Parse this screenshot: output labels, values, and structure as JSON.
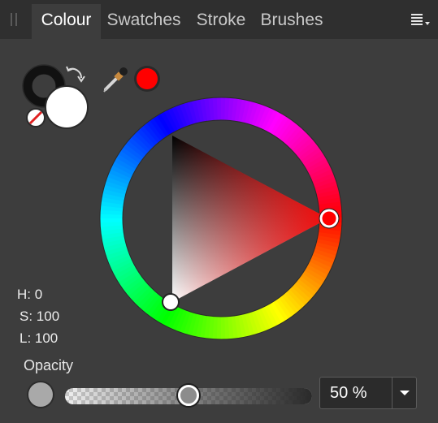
{
  "tabs": [
    {
      "label": "Colour",
      "active": true
    },
    {
      "label": "Swatches",
      "active": false
    },
    {
      "label": "Stroke",
      "active": false
    },
    {
      "label": "Brushes",
      "active": false
    }
  ],
  "panel_menu_icon": "hamburger-menu-icon",
  "colour": {
    "fill_color": "#ffffff",
    "stroke_color": "#111111",
    "picked_color": "#ff0000",
    "hue": "H: 0",
    "saturation": "S: 100",
    "lightness": "L: 100",
    "icons": {
      "swap": "swap-arrows-icon",
      "no_fill": "no-fill-icon",
      "eyedropper": "eyedropper-icon"
    }
  },
  "opacity": {
    "label": "Opacity",
    "value": 0.5,
    "display": "50 %",
    "swatch_color": "#a9a9a9"
  }
}
